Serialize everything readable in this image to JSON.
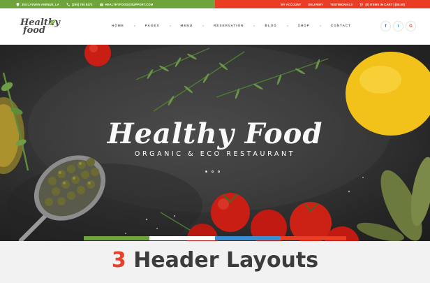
{
  "topbar": {
    "address": "353 LAYMAN AVENUE, LA",
    "phone": "(206) 755 8472",
    "email": "HEALTHYFOOD@SUPPORT.COM",
    "my_account": "MY ACCOUNT",
    "delivery": "DELIVERY",
    "testimonials": "TESTIMONIALS",
    "cart": "(0) ITEMS IN CART | ($0.00)"
  },
  "logo": {
    "line1": "Healthy",
    "line2": "food"
  },
  "nav": [
    "HOME",
    "PAGES",
    "MENU",
    "RESERVATION",
    "BLOG",
    "SHOP",
    "CONTACT"
  ],
  "social": [
    "f",
    "t",
    "G"
  ],
  "hero": {
    "title": "Healthy Food",
    "subtitle": "ORGANIC & ECO RESTAURANT"
  },
  "caption": {
    "number": "3",
    "text": " Header Layouts"
  },
  "colors": {
    "green": "#6fa33b",
    "red": "#ea3d25",
    "blue": "#3a8fd4",
    "dark": "#2f2f2f"
  }
}
